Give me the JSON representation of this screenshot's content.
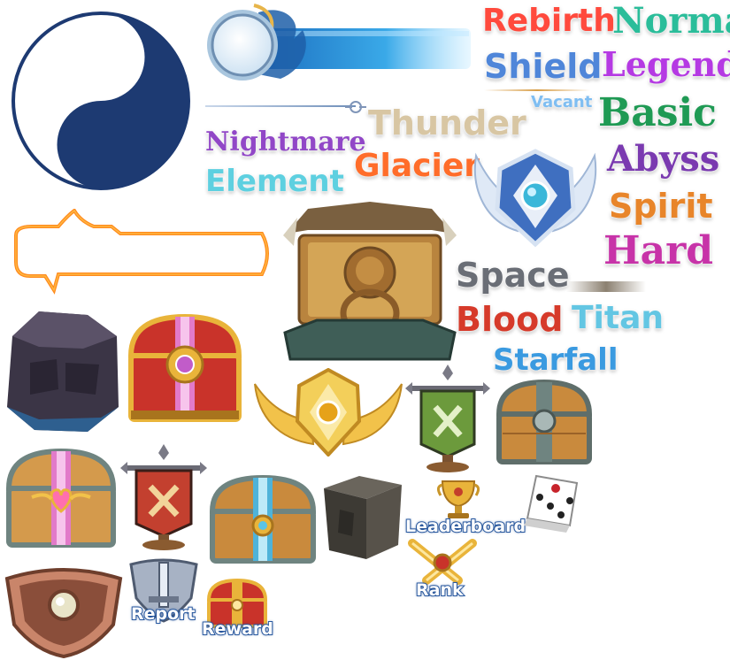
{
  "words": {
    "rebirth": "Rebirth",
    "normal": "Normal",
    "shield": "Shield",
    "legend": "Legend",
    "vacant": "Vacant",
    "basic": "Basic",
    "thunder": "Thunder",
    "nightmare": "Nightmare",
    "element": "Element",
    "glacier": "Glacier",
    "abyss": "Abyss",
    "spirit": "Spirit",
    "hard": "Hard",
    "space": "Space",
    "blood": "Blood",
    "titan": "Titan",
    "starfall": "Starfall"
  },
  "labels": {
    "leaderboard": "Leaderboard",
    "rank": "Rank",
    "report": "Report",
    "reward": "Reward"
  },
  "colors": {
    "yin_yang_navy": "#1d3a72",
    "bar_blue": "#3aa9e8",
    "orange_glow": "#ff8a1e",
    "chest_red": "#c9332a",
    "chest_gold": "#e9b43a",
    "chest_wood": "#c98a3d",
    "banner_red": "#c3402f",
    "banner_green": "#6c9a3c"
  }
}
